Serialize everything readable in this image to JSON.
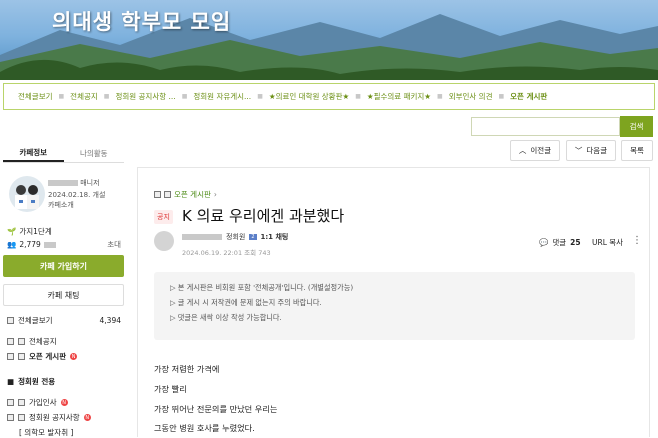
{
  "banner": {
    "title": "의대생 학부모 모임"
  },
  "menu": {
    "items": [
      "전체글보기",
      "전체공지",
      "정회원 공지사항 ...",
      "정회원 자유게시...",
      "★의료인 대학원 상황판★",
      "★필수의료 패키지★",
      "외부인사 의견",
      "오픈 게시판"
    ]
  },
  "search": {
    "placeholder": "",
    "button": "검색"
  },
  "nav": {
    "prev": "이전글",
    "next": "다음글",
    "list": "목록"
  },
  "sidebar": {
    "tab_cafe": "카페정보",
    "tab_mine": "나의활동",
    "manager": "매니저",
    "created": "2024.02.18. 개설",
    "intro": "카페소개",
    "level": "가지1단계",
    "member_count": "2,779",
    "invite": "초대",
    "join": "카페 가입하기",
    "chat": "카페 채팅",
    "all_posts_label": "전체글보기",
    "all_posts_count": "4,394",
    "board_notice": "전체공지",
    "board_open": "오픈 게시판",
    "section_member": "정회원 전용",
    "board_greeting": "가입인사",
    "board_member_notice": "정회원 공지사항",
    "board_doctor": "[ 의학모 발자취 ]",
    "new_badge": "N"
  },
  "post": {
    "board": "오픈 게시판",
    "notice_badge": "공지",
    "title": "K 의료 우리에겐 과분했다",
    "role": "정회원",
    "chat": "1:1 채팅",
    "date": "2024.06.19. 22:01",
    "views": "조회 743",
    "comment_label": "댓글",
    "comment_count": "25",
    "url_copy": "URL 복사",
    "notices": [
      "▷ 본 게시판은 비회원 포함 '전체공개'입니다. (개별설정가능)",
      "▷ 글 게시 시 저작권에 문제 없는지 주의 바랍니다.",
      "▷ 댓글은 새싹 이상 작성 가능합니다."
    ],
    "lines": [
      "가장 저렴한 가격에",
      "가장 빨리",
      "가장 뛰어난 전문의를 만났던 우리는",
      "그동안 병원 호사를 누렸었다."
    ]
  },
  "colors": {
    "accent": "#8aab2c",
    "menu_text": "#6b8f14",
    "new_badge": "#ee4444"
  }
}
